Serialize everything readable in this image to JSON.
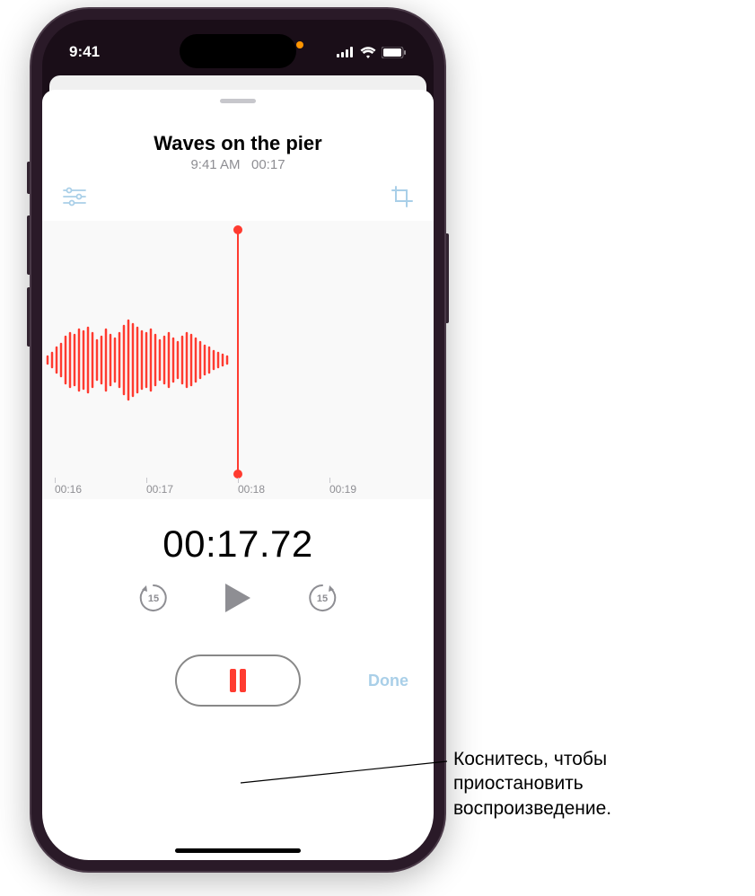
{
  "status": {
    "time": "9:41",
    "orange_dot": true,
    "cell_bars": 4,
    "wifi": true,
    "battery_pct": 100
  },
  "recording": {
    "title": "Waves on the pier",
    "meta_time": "9:41 AM",
    "meta_duration": "00:17"
  },
  "timeline": {
    "ticks": [
      "00:16",
      "00:17",
      "00:18",
      "00:19"
    ]
  },
  "elapsed": "00:17.72",
  "skip_seconds": "15",
  "buttons": {
    "done_label": "Done"
  },
  "callout": {
    "line1": "Коснитесь, чтобы",
    "line2": "приостановить",
    "line3": "воспроизведение."
  }
}
